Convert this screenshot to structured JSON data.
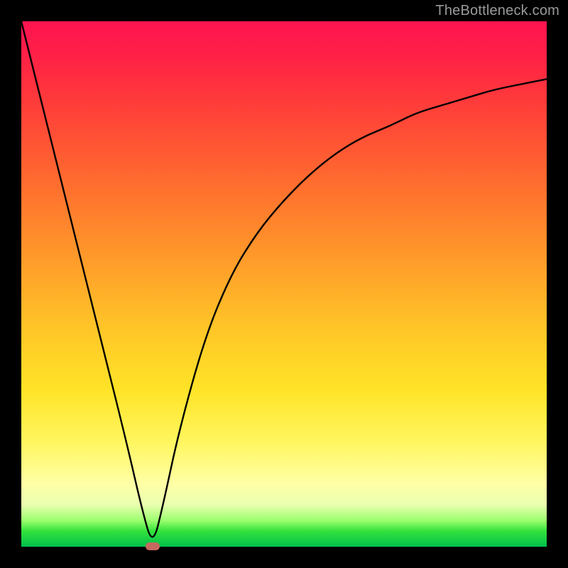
{
  "watermark": "TheBottleneck.com",
  "chart_data": {
    "type": "line",
    "title": "",
    "xlabel": "",
    "ylabel": "",
    "xlim": [
      0,
      100
    ],
    "ylim": [
      0,
      100
    ],
    "gradient_meaning": "top=red=high-bottleneck, bottom=green=low-bottleneck",
    "min_point": {
      "x": 25,
      "y": 0
    },
    "series": [
      {
        "name": "bottleneck-curve",
        "x": [
          0,
          5,
          10,
          15,
          20,
          23,
          25,
          27,
          30,
          35,
          40,
          45,
          50,
          55,
          60,
          65,
          70,
          75,
          80,
          85,
          90,
          95,
          100
        ],
        "y": [
          100,
          80,
          60,
          40,
          20,
          7,
          0,
          8,
          22,
          40,
          52,
          60,
          66,
          71,
          75,
          78,
          80,
          82.5,
          84,
          85.5,
          87,
          88,
          89
        ]
      }
    ],
    "marker": {
      "shape": "rounded-rect",
      "color": "#c66a5f",
      "at": "min_point"
    }
  },
  "colors": {
    "frame": "#000000",
    "watermark": "#9a9a9a",
    "curve": "#000000",
    "marker": "#c66a5f"
  }
}
